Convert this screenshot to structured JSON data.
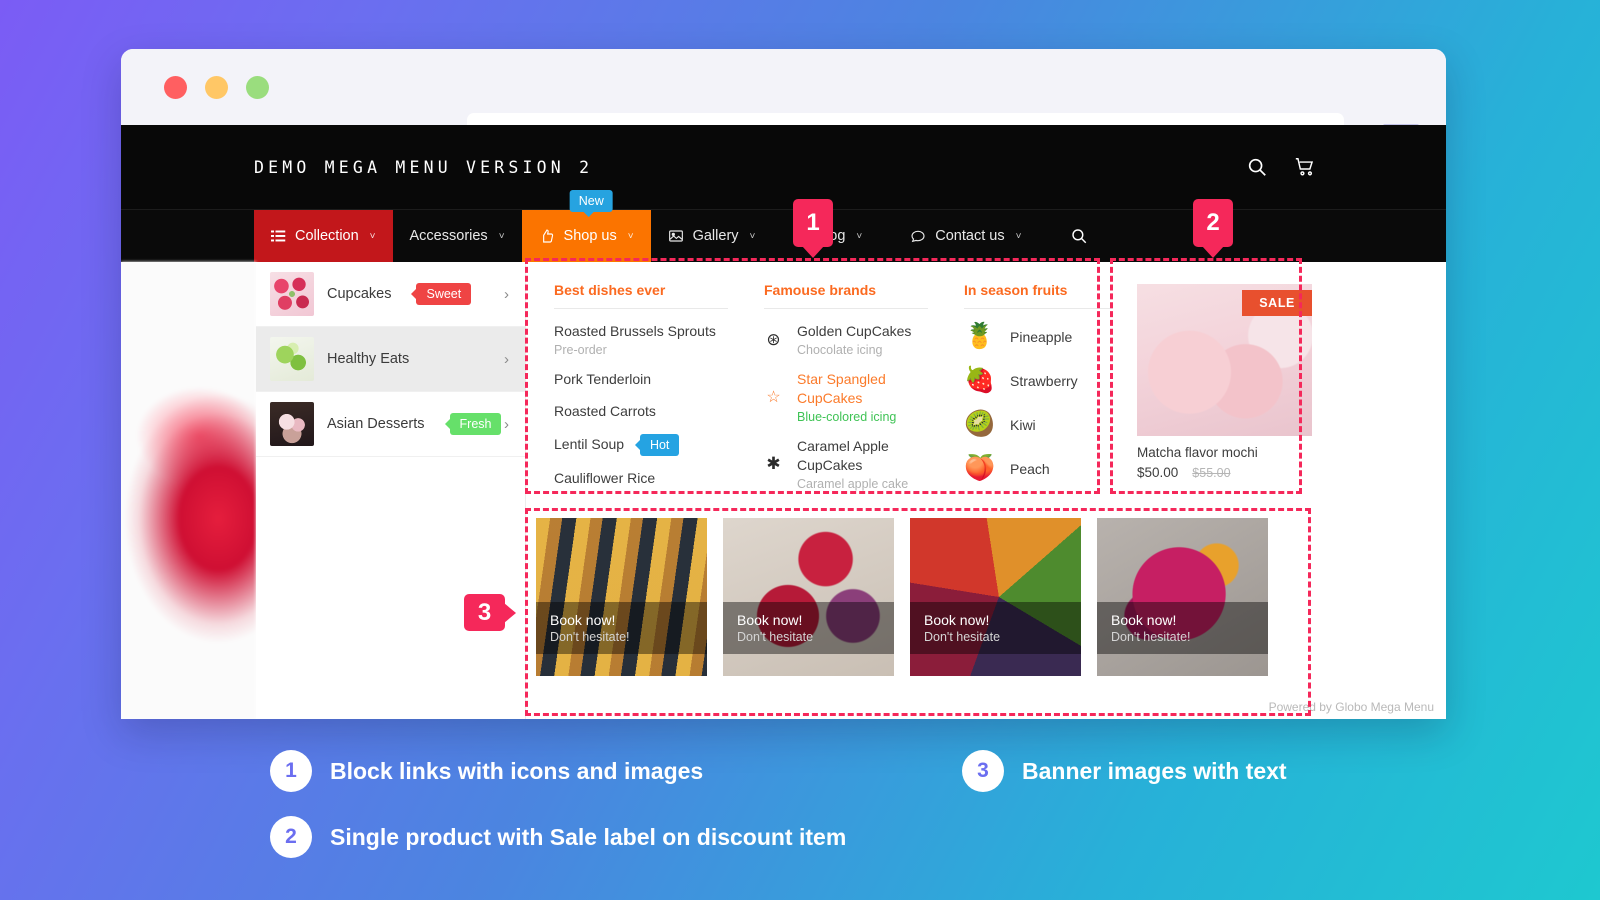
{
  "browser": {
    "traffic_lights": [
      "close",
      "minimize",
      "maximize"
    ],
    "url_value": "",
    "url_placeholder": ""
  },
  "site": {
    "brand": "DEMO MEGA MENU VERSION 2",
    "header_icons": [
      "search-icon",
      "cart-icon"
    ]
  },
  "nav": {
    "items": [
      {
        "label": "Collection",
        "icon": "list-icon",
        "state": "active-red",
        "chevron": "˅",
        "badge": null
      },
      {
        "label": "Accessories",
        "icon": null,
        "state": "default",
        "chevron": "˅",
        "badge": null
      },
      {
        "label": "Shop us",
        "icon": "thumbs-up-icon",
        "state": "active-orange",
        "chevron": "˅",
        "badge": "New"
      },
      {
        "label": "Gallery",
        "icon": "image-icon",
        "state": "default",
        "chevron": "˅",
        "badge": null
      },
      {
        "label": "Blog",
        "icon": null,
        "state": "default",
        "chevron": "˅",
        "badge": null
      },
      {
        "label": "Contact us",
        "icon": "chat-icon",
        "state": "default",
        "chevron": "˅",
        "badge": null
      }
    ],
    "search_icon": "search-icon"
  },
  "sidebar": {
    "items": [
      {
        "label": "Cupcakes",
        "badge": "Sweet",
        "badge_color": "#ef4444",
        "thumb": "cupcakes-thumb",
        "arrow": "›",
        "hovered": false
      },
      {
        "label": "Healthy Eats",
        "badge": null,
        "badge_color": null,
        "thumb": "healthy-eats-thumb",
        "arrow": "›",
        "hovered": true
      },
      {
        "label": "Asian Desserts",
        "badge": "Fresh",
        "badge_color": "#66e06a",
        "thumb": "asian-desserts-thumb",
        "arrow": "›",
        "hovered": false
      }
    ]
  },
  "mega": {
    "columns": [
      {
        "title": "Best dishes ever",
        "type": "links",
        "links": [
          {
            "label": "Roasted Brussels Sprouts",
            "sub": "Pre-order",
            "badge": null
          },
          {
            "label": "Pork Tenderloin",
            "sub": null,
            "badge": null
          },
          {
            "label": "Roasted Carrots",
            "sub": null,
            "badge": null
          },
          {
            "label": "Lentil Soup",
            "sub": null,
            "badge": "Hot",
            "badge_color": "#25a3e2"
          },
          {
            "label": "Cauliflower Rice",
            "sub": null,
            "badge": null
          }
        ]
      },
      {
        "title": "Famouse brands",
        "type": "icon-links",
        "links": [
          {
            "icon": "circled-asterisk-icon",
            "glyph": "⊛",
            "label": "Golden CupCakes",
            "sub": "Chocolate icing",
            "highlight": false
          },
          {
            "icon": "star-outline-icon",
            "glyph": "☆",
            "label": "Star Spangled CupCakes",
            "sub": "Blue-colored icing",
            "highlight": true
          },
          {
            "icon": "asterisk-icon",
            "glyph": "✱",
            "label": "Caramel Apple CupCakes",
            "sub": "Caramel apple cake",
            "highlight": false
          }
        ]
      },
      {
        "title": "In season fruits",
        "type": "emoji-links",
        "links": [
          {
            "emoji": "🍍",
            "icon": "pineapple-icon",
            "label": "Pineapple"
          },
          {
            "emoji": "🍓",
            "icon": "strawberry-icon",
            "label": "Strawberry"
          },
          {
            "emoji": "🥝",
            "icon": "kiwi-icon",
            "label": "Kiwi"
          },
          {
            "emoji": "🍑",
            "icon": "peach-icon",
            "label": "Peach"
          }
        ]
      }
    ],
    "product": {
      "sale_label": "SALE",
      "name": "Matcha flavor mochi",
      "price": "$50.00",
      "compare_price": "$55.00"
    },
    "banners": [
      {
        "title": "Book now!",
        "sub": "Don't hesitate!",
        "image": "hotdogs-banner"
      },
      {
        "title": "Book now!",
        "sub": "Don't hesitate",
        "image": "berry-cake-banner"
      },
      {
        "title": "Book now!",
        "sub": "Don't hesitate",
        "image": "fruit-platter-banner"
      },
      {
        "title": "Book now!",
        "sub": "Don't hesitate!",
        "image": "berry-platter-banner"
      }
    ],
    "powered_by": "Powered by Globo Mega Menu"
  },
  "annotations": {
    "markers": [
      {
        "number": "1"
      },
      {
        "number": "2"
      },
      {
        "number": "3"
      }
    ]
  },
  "captions": [
    {
      "number": "1",
      "text": "Block links with icons and images"
    },
    {
      "number": "2",
      "text": "Single product with Sale label on discount item"
    },
    {
      "number": "3",
      "text": "Banner images with text"
    }
  ]
}
